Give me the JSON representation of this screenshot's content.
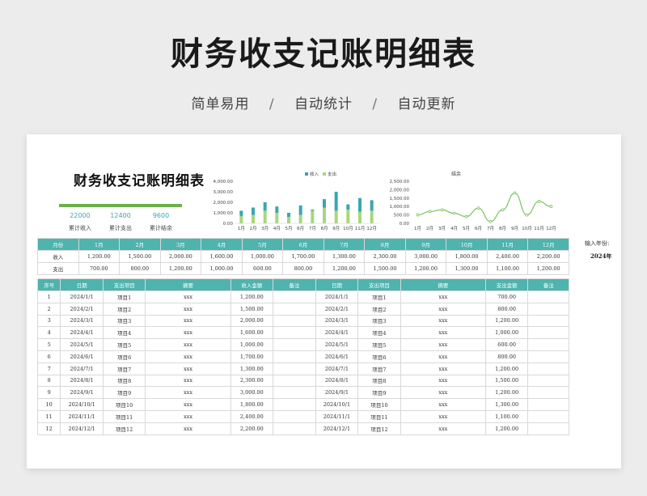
{
  "banner": {
    "title": "财务收支记账明细表",
    "tags": [
      "简单易用",
      "自动统计",
      "自动更新"
    ],
    "separator": "/"
  },
  "sheet": {
    "title": "财务收支记账明细表",
    "side_label": "输入年份:",
    "year": "2024年"
  },
  "kpis": [
    {
      "value": "22000",
      "label": "累计收入",
      "fill_pct": 100
    },
    {
      "value": "12400",
      "label": "累计支出",
      "fill_pct": 100
    },
    {
      "value": "9600",
      "label": "累计结余",
      "fill_pct": 100
    }
  ],
  "colors": {
    "income": "#3aa6b0",
    "expense": "#a8d67e",
    "balance_line": "#7cc25a",
    "header": "#4fb3ae"
  },
  "chart_data": [
    {
      "type": "bar",
      "stacked": true,
      "categories": [
        "1月",
        "2月",
        "3月",
        "4月",
        "5月",
        "6月",
        "7月",
        "8月",
        "9月",
        "10月",
        "11月",
        "12月"
      ],
      "series": [
        {
          "name": "收入",
          "values": [
            1200,
            1500,
            2000,
            1600,
            1000,
            1700,
            1300,
            2300,
            3000,
            1800,
            2400,
            2200
          ]
        },
        {
          "name": "支出",
          "values": [
            700,
            800,
            1200,
            1000,
            600,
            800,
            1200,
            1500,
            1200,
            1300,
            1100,
            1200
          ]
        }
      ],
      "yticks": [
        "0.00",
        "1,000.00",
        "2,000.00",
        "3,000.00",
        "4,000.00"
      ],
      "ylim": [
        0,
        4000
      ],
      "legend": "top"
    },
    {
      "type": "line",
      "title": "结余",
      "categories": [
        "1月",
        "2月",
        "3月",
        "4月",
        "5月",
        "6月",
        "7月",
        "8月",
        "9月",
        "10月",
        "11月",
        "12月"
      ],
      "series": [
        {
          "values": [
            500,
            700,
            800,
            600,
            400,
            900,
            100,
            800,
            1800,
            500,
            1300,
            1000
          ]
        }
      ],
      "yticks": [
        "0.00",
        "500.00",
        "1,000.00",
        "1,500.00",
        "2,000.00",
        "2,500.00"
      ],
      "ylim": [
        0,
        2500
      ]
    }
  ],
  "monthly": {
    "header": [
      "月份",
      "1月",
      "2月",
      "3月",
      "4月",
      "5月",
      "6月",
      "7月",
      "8月",
      "9月",
      "10月",
      "11月",
      "12月"
    ],
    "rows": [
      [
        "收入",
        "1,200.00",
        "1,500.00",
        "2,000.00",
        "1,600.00",
        "1,000.00",
        "1,700.00",
        "1,300.00",
        "2,300.00",
        "3,000.00",
        "1,800.00",
        "2,400.00",
        "2,200.00"
      ],
      [
        "支出",
        "700.00",
        "800.00",
        "1,200.00",
        "1,000.00",
        "600.00",
        "800.00",
        "1,200.00",
        "1,500.00",
        "1,200.00",
        "1,300.00",
        "1,100.00",
        "1,200.00"
      ]
    ]
  },
  "detail": {
    "header": [
      "序号",
      "日期",
      "支出项目",
      "摘要",
      "收入金额",
      "备注",
      "日期",
      "支出项目",
      "摘要",
      "支出金额",
      "备注"
    ],
    "rows": [
      [
        "1",
        "2024/1/1",
        "项目1",
        "xxx",
        "1,200.00",
        "",
        "2024/1/1",
        "项目1",
        "xxx",
        "700.00",
        ""
      ],
      [
        "2",
        "2024/2/1",
        "项目2",
        "xxx",
        "1,500.00",
        "",
        "2024/2/1",
        "项目2",
        "xxx",
        "800.00",
        ""
      ],
      [
        "3",
        "2024/3/1",
        "项目3",
        "xxx",
        "2,000.00",
        "",
        "2024/3/1",
        "项目3",
        "xxx",
        "1,200.00",
        ""
      ],
      [
        "4",
        "2024/4/1",
        "项目4",
        "xxx",
        "1,600.00",
        "",
        "2024/4/1",
        "项目4",
        "xxx",
        "1,000.00",
        ""
      ],
      [
        "5",
        "2024/5/1",
        "项目5",
        "xxx",
        "1,000.00",
        "",
        "2024/5/1",
        "项目5",
        "xxx",
        "600.00",
        ""
      ],
      [
        "6",
        "2024/6/1",
        "项目6",
        "xxx",
        "1,700.00",
        "",
        "2024/6/1",
        "项目6",
        "xxx",
        "800.00",
        ""
      ],
      [
        "7",
        "2024/7/1",
        "项目7",
        "xxx",
        "1,300.00",
        "",
        "2024/7/1",
        "项目7",
        "xxx",
        "1,200.00",
        ""
      ],
      [
        "8",
        "2024/8/1",
        "项目8",
        "xxx",
        "2,300.00",
        "",
        "2024/8/1",
        "项目8",
        "xxx",
        "1,500.00",
        ""
      ],
      [
        "9",
        "2024/9/1",
        "项目9",
        "xxx",
        "3,000.00",
        "",
        "2024/9/1",
        "项目9",
        "xxx",
        "1,200.00",
        ""
      ],
      [
        "10",
        "2024/10/1",
        "项目10",
        "xxx",
        "1,800.00",
        "",
        "2024/10/1",
        "项目10",
        "xxx",
        "1,300.00",
        ""
      ],
      [
        "11",
        "2024/11/1",
        "项目11",
        "xxx",
        "2,400.00",
        "",
        "2024/11/1",
        "项目11",
        "xxx",
        "1,100.00",
        ""
      ],
      [
        "12",
        "2024/12/1",
        "项目12",
        "xxx",
        "2,200.00",
        "",
        "2024/12/1",
        "项目12",
        "xxx",
        "1,200.00",
        ""
      ]
    ]
  }
}
